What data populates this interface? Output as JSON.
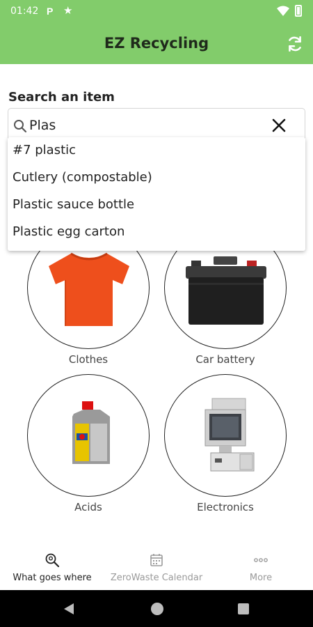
{
  "status_bar": {
    "time": "01:42",
    "p_badge": "P"
  },
  "app": {
    "title": "EZ Recycling"
  },
  "search": {
    "label": "Search an item",
    "value": "Plas",
    "suggestions": [
      "#7 plastic",
      "Cutlery (compostable)",
      "Plastic sauce bottle",
      "Plastic egg carton"
    ]
  },
  "categories": [
    {
      "label": "Clothes",
      "icon": "tshirt-image"
    },
    {
      "label": "Car battery",
      "icon": "car-battery-image"
    },
    {
      "label": "Acids",
      "icon": "acid-bottle-image"
    },
    {
      "label": "Electronics",
      "icon": "computer-image"
    }
  ],
  "bottom_nav": [
    {
      "label": "What goes where",
      "icon": "search-location-icon",
      "active": true
    },
    {
      "label": "ZeroWaste Calendar",
      "icon": "calendar-icon",
      "active": false
    },
    {
      "label": "More",
      "icon": "more-dots-icon",
      "active": false
    }
  ],
  "colors": {
    "app_bar": "#82cc6b",
    "active_nav": "#222222",
    "inactive_nav": "#9a9a9a"
  }
}
